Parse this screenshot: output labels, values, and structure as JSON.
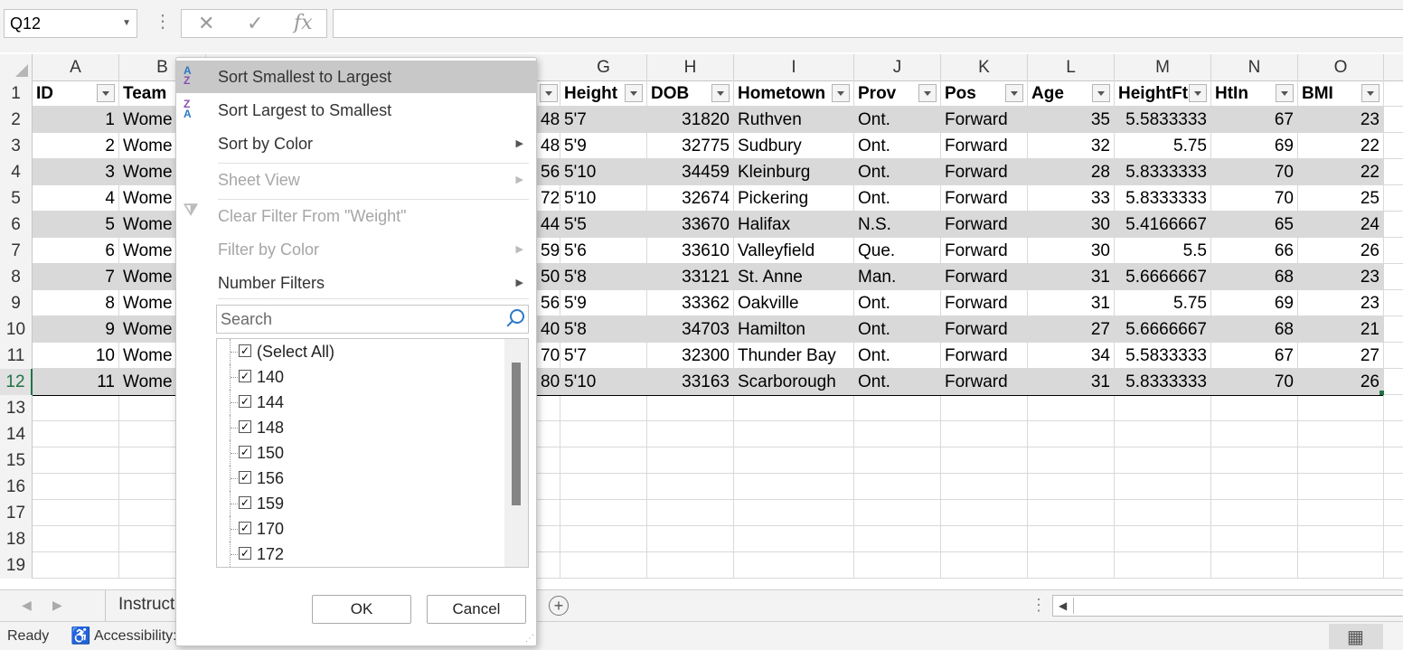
{
  "formula_bar": {
    "name_box": "Q12",
    "cancel_icon": "✕",
    "enter_icon": "✓",
    "fx_label": "fx",
    "formula": ""
  },
  "columns": [
    {
      "letter": "A",
      "header": "ID"
    },
    {
      "letter": "B",
      "header": "Team"
    },
    {
      "letter": "G",
      "header": "Height"
    },
    {
      "letter": "H",
      "header": "DOB"
    },
    {
      "letter": "I",
      "header": "Hometown"
    },
    {
      "letter": "J",
      "header": "Prov"
    },
    {
      "letter": "K",
      "header": "Pos"
    },
    {
      "letter": "L",
      "header": "Age"
    },
    {
      "letter": "M",
      "header": "HeightFt"
    },
    {
      "letter": "N",
      "header": "HtIn"
    },
    {
      "letter": "O",
      "header": "BMI"
    }
  ],
  "rows": [
    {
      "n": "2",
      "id": "1",
      "team": "Wome",
      "weight": "48",
      "height": "5'7",
      "dob": "31820",
      "hometown": "Ruthven",
      "prov": "Ont.",
      "pos": "Forward",
      "age": "35",
      "heightft": "5.5833333",
      "htin": "67",
      "bmi": "23"
    },
    {
      "n": "3",
      "id": "2",
      "team": "Wome",
      "weight": "48",
      "height": "5'9",
      "dob": "32775",
      "hometown": "Sudbury",
      "prov": "Ont.",
      "pos": "Forward",
      "age": "32",
      "heightft": "5.75",
      "htin": "69",
      "bmi": "22"
    },
    {
      "n": "4",
      "id": "3",
      "team": "Wome",
      "weight": "56",
      "height": "5'10",
      "dob": "34459",
      "hometown": "Kleinburg",
      "prov": "Ont.",
      "pos": "Forward",
      "age": "28",
      "heightft": "5.8333333",
      "htin": "70",
      "bmi": "22"
    },
    {
      "n": "5",
      "id": "4",
      "team": "Wome",
      "weight": "72",
      "height": "5'10",
      "dob": "32674",
      "hometown": "Pickering",
      "prov": "Ont.",
      "pos": "Forward",
      "age": "33",
      "heightft": "5.8333333",
      "htin": "70",
      "bmi": "25"
    },
    {
      "n": "6",
      "id": "5",
      "team": "Wome",
      "weight": "44",
      "height": "5'5",
      "dob": "33670",
      "hometown": "Halifax",
      "prov": "N.S.",
      "pos": "Forward",
      "age": "30",
      "heightft": "5.4166667",
      "htin": "65",
      "bmi": "24"
    },
    {
      "n": "7",
      "id": "6",
      "team": "Wome",
      "weight": "59",
      "height": "5'6",
      "dob": "33610",
      "hometown": "Valleyfield",
      "prov": "Que.",
      "pos": "Forward",
      "age": "30",
      "heightft": "5.5",
      "htin": "66",
      "bmi": "26"
    },
    {
      "n": "8",
      "id": "7",
      "team": "Wome",
      "weight": "50",
      "height": "5'8",
      "dob": "33121",
      "hometown": "St. Anne",
      "prov": "Man.",
      "pos": "Forward",
      "age": "31",
      "heightft": "5.6666667",
      "htin": "68",
      "bmi": "23"
    },
    {
      "n": "9",
      "id": "8",
      "team": "Wome",
      "weight": "56",
      "height": "5'9",
      "dob": "33362",
      "hometown": "Oakville",
      "prov": "Ont.",
      "pos": "Forward",
      "age": "31",
      "heightft": "5.75",
      "htin": "69",
      "bmi": "23"
    },
    {
      "n": "10",
      "id": "9",
      "team": "Wome",
      "weight": "40",
      "height": "5'8",
      "dob": "34703",
      "hometown": "Hamilton",
      "prov": "Ont.",
      "pos": "Forward",
      "age": "27",
      "heightft": "5.6666667",
      "htin": "68",
      "bmi": "21"
    },
    {
      "n": "11",
      "id": "10",
      "team": "Wome",
      "weight": "70",
      "height": "5'7",
      "dob": "32300",
      "hometown": "Thunder Bay",
      "prov": "Ont.",
      "pos": "Forward",
      "age": "34",
      "heightft": "5.5833333",
      "htin": "67",
      "bmi": "27"
    },
    {
      "n": "12",
      "id": "11",
      "team": "Wome",
      "weight": "80",
      "height": "5'10",
      "dob": "33163",
      "hometown": "Scarborough",
      "prov": "Ont.",
      "pos": "Forward",
      "age": "31",
      "heightft": "5.8333333",
      "htin": "70",
      "bmi": "26"
    }
  ],
  "header_row_number": "1",
  "empty_rows": [
    "13",
    "14",
    "15",
    "16",
    "17",
    "18",
    "19"
  ],
  "filter_menu": {
    "sort_asc": "Sort Smallest to Largest",
    "sort_desc": "Sort Largest to Smallest",
    "sort_by_color": "Sort by Color",
    "sheet_view": "Sheet View",
    "clear_filter": "Clear Filter From \"Weight\"",
    "filter_by_color": "Filter by Color",
    "number_filters": "Number Filters",
    "search_placeholder": "Search",
    "values": [
      "(Select All)",
      "140",
      "144",
      "148",
      "150",
      "156",
      "159",
      "170",
      "172"
    ],
    "ok": "OK",
    "cancel": "Cancel"
  },
  "sheet_tabs": {
    "active": "Instruct"
  },
  "status_bar": {
    "ready": "Ready",
    "accessibility": "Accessibility:"
  },
  "colors": {
    "excel_green": "#217346",
    "band": "#d9d9d9",
    "menu_hover": "#c8c8c8"
  }
}
